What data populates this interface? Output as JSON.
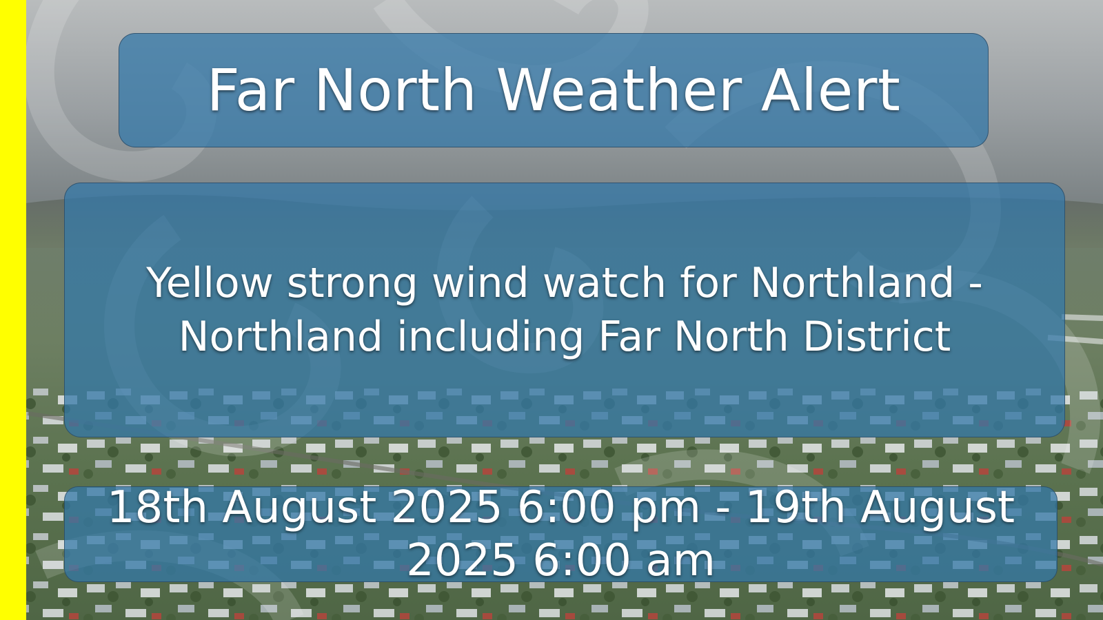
{
  "alert": {
    "title": "Far North Weather Alert",
    "message": "Yellow strong wind watch for Northland - Northland including Far North District",
    "period": "18th August 2025 6:00 pm - 19th August 2025 6:00 am"
  },
  "colors": {
    "alert_level": "#ffff00",
    "panel_fill": "#3378a8",
    "text": "#ffffff",
    "sky": "#8f9496",
    "land": "#5f7a4e"
  },
  "icons": {
    "background_pattern": "koru-swirl-pattern",
    "background_photo": "aerial-town-photo"
  }
}
